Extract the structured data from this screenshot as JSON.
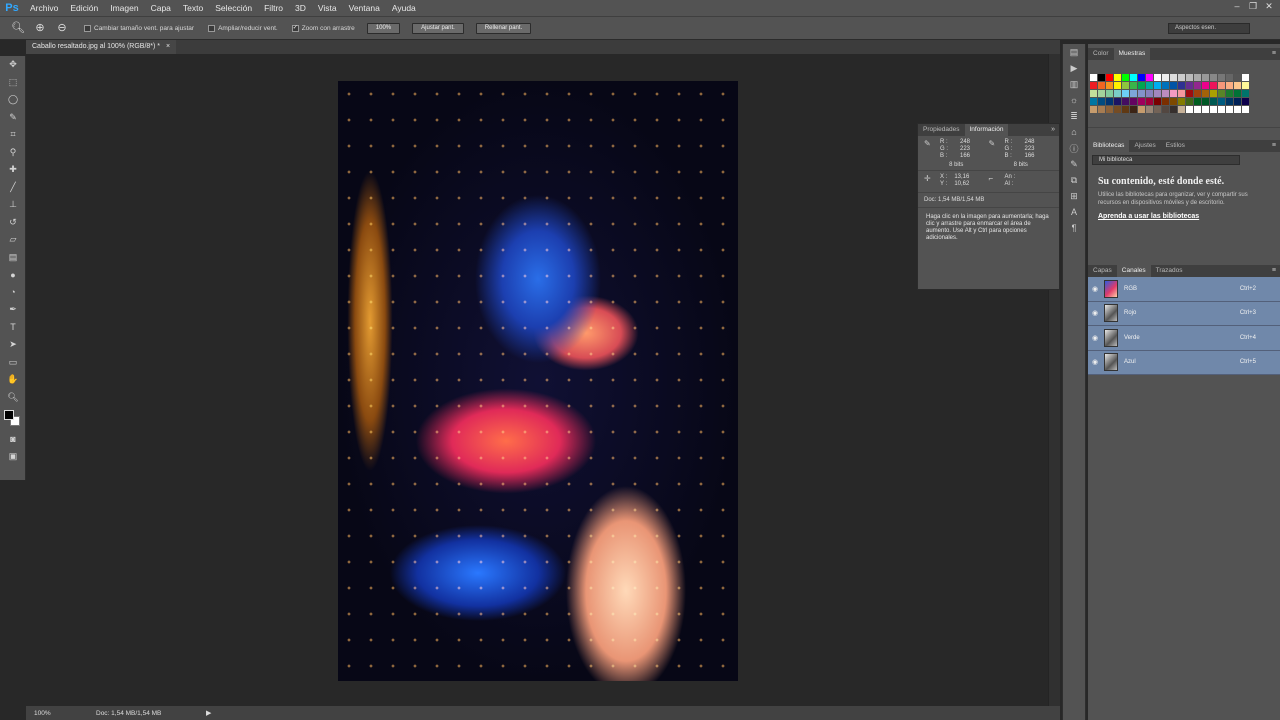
{
  "app": {
    "logo": "Ps"
  },
  "menu": [
    "Archivo",
    "Edición",
    "Imagen",
    "Capa",
    "Texto",
    "Selección",
    "Filtro",
    "3D",
    "Vista",
    "Ventana",
    "Ayuda"
  ],
  "window_controls": [
    "minimize-icon",
    "restore-icon",
    "close-icon"
  ],
  "options": {
    "resize_label": "Cambiar tamaño vent. para ajustar",
    "zoom_all_label": "Ampliar/reducir vent.",
    "scrubby_label": "Zoom con arrastre",
    "zoom_value": "100%",
    "fit_label": "Ajustar pant.",
    "fill_label": "Rellenar pant.",
    "workspace": "Aspectos esen."
  },
  "document": {
    "tab_title": "Caballo resaltado.jpg al 100% (RGB/8*) *",
    "close": "×"
  },
  "status": {
    "zoom": "100%",
    "doc_size": "Doc: 1,54 MB/1,54 MB",
    "arrow": "▶"
  },
  "info_panel": {
    "tabs": [
      "Propiedades",
      "Información"
    ],
    "active_tab": 1,
    "menu": "»",
    "left": {
      "labels": [
        "R :",
        "G :",
        "B :"
      ],
      "values": [
        "248",
        "223",
        "166"
      ]
    },
    "right": {
      "labels": [
        "R :",
        "G :",
        "B :"
      ],
      "values": [
        "248",
        "223",
        "166"
      ]
    },
    "bits_left": "8 bits",
    "bits_right": "8 bits",
    "coords": {
      "labels": [
        "X :",
        "Y :"
      ],
      "values": [
        "13,16",
        "10,62"
      ]
    },
    "size": {
      "labels": [
        "An :",
        "Al :"
      ],
      "values": [
        "",
        ""
      ]
    },
    "doc": "Doc: 1,54 MB/1,54 MB",
    "help": "Haga clic en la imagen para aumentarla; haga clic y arrastre para enmarcar el área de aumento. Use Alt y Ctrl para opciones adicionales."
  },
  "swatches_panel": {
    "tabs": [
      "Color",
      "Muestras"
    ],
    "active_tab": 1,
    "colors": [
      "#ffffff",
      "#000000",
      "#ff0000",
      "#ffff00",
      "#00ff00",
      "#00ffff",
      "#0000ff",
      "#ff00ff",
      "#ffffff",
      "#eeeeee",
      "#dddddd",
      "#cccccc",
      "#bbbbbb",
      "#aaaaaa",
      "#999999",
      "#888888",
      "#777777",
      "#666666",
      "#555555",
      "#ffffff",
      "#ed1c24",
      "#f26522",
      "#f7941d",
      "#fff200",
      "#8dc63f",
      "#39b54a",
      "#00a651",
      "#00a99d",
      "#00aeef",
      "#0072bc",
      "#0054a6",
      "#2e3192",
      "#662d91",
      "#92278f",
      "#ec008c",
      "#ed145b",
      "#f7977a",
      "#fbad82",
      "#fdc68c",
      "#fff799",
      "#c4df9b",
      "#a3d39c",
      "#82ca9c",
      "#7accc8",
      "#6dcff6",
      "#7da7d9",
      "#8393ca",
      "#8781bd",
      "#a186be",
      "#bc8cbf",
      "#f49ac1",
      "#f5989d",
      "#9e0b0f",
      "#a0410d",
      "#a36209",
      "#aba000",
      "#598527",
      "#1a7b30",
      "#007236",
      "#00746b",
      "#0076a3",
      "#004b80",
      "#003471",
      "#1b1464",
      "#440e62",
      "#630460",
      "#9e005d",
      "#9e0039",
      "#790000",
      "#7b2e00",
      "#7d4900",
      "#827b00",
      "#406618",
      "#005e20",
      "#005826",
      "#005952",
      "#005b7f",
      "#003663",
      "#002157",
      "#0d004c",
      "#c69c6d",
      "#a67c52",
      "#8c6239",
      "#754c24",
      "#603913",
      "#3c2415",
      "#c69c6d",
      "#998675",
      "#736357",
      "#534741",
      "#362f2d",
      "#c7b299",
      "#ffffff",
      "#ffffff",
      "#ffffff",
      "#ffffff",
      "#ffffff",
      "#ffffff",
      "#ffffff",
      "#ffffff"
    ]
  },
  "libraries_panel": {
    "tabs": [
      "Bibliotecas",
      "Ajustes",
      "Estilos"
    ],
    "active_tab": 0,
    "selected_library": "Mi biblioteca",
    "heading": "Su contenido, esté donde esté.",
    "body": "Utilice las bibliotecas para organizar, ver y compartir sus recursos en dispositivos móviles y de escritorio.",
    "link": "Aprenda a usar las bibliotecas"
  },
  "channels_panel": {
    "tabs": [
      "Capas",
      "Canales",
      "Trazados"
    ],
    "active_tab": 1,
    "rows": [
      {
        "name": "RGB",
        "shortcut": "Ctrl+2"
      },
      {
        "name": "Rojo",
        "shortcut": "Ctrl+3"
      },
      {
        "name": "Verde",
        "shortcut": "Ctrl+4"
      },
      {
        "name": "Azul",
        "shortcut": "Ctrl+5"
      }
    ]
  },
  "tools": [
    "move-tool-icon",
    "marquee-tool-icon",
    "lasso-tool-icon",
    "quick-select-tool-icon",
    "crop-tool-icon",
    "eyedropper-tool-icon",
    "healing-brush-tool-icon",
    "brush-tool-icon",
    "clone-stamp-tool-icon",
    "history-brush-tool-icon",
    "eraser-tool-icon",
    "gradient-tool-icon",
    "blur-tool-icon",
    "dodge-tool-icon",
    "pen-tool-icon",
    "type-tool-icon",
    "path-select-tool-icon",
    "rectangle-tool-icon",
    "hand-tool-icon",
    "zoom-tool-icon"
  ]
}
